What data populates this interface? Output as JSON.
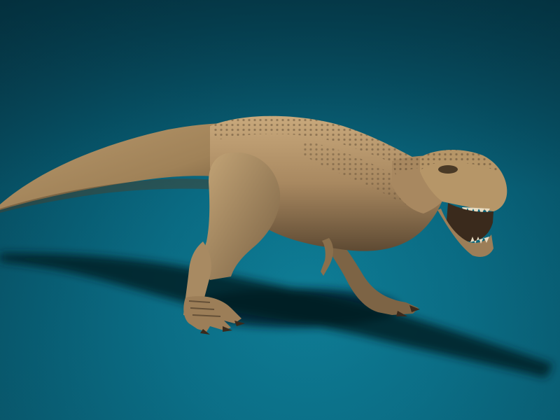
{
  "scene": {
    "subject": "tyrannosaurus-rex-3d-render",
    "colors": {
      "background_center": "#0e7c95",
      "background_edge": "#063f50",
      "skin_light": "#c9a97c",
      "skin_mid": "#a88860",
      "skin_dark": "#5e4a33",
      "shadow": "#021c24"
    }
  }
}
